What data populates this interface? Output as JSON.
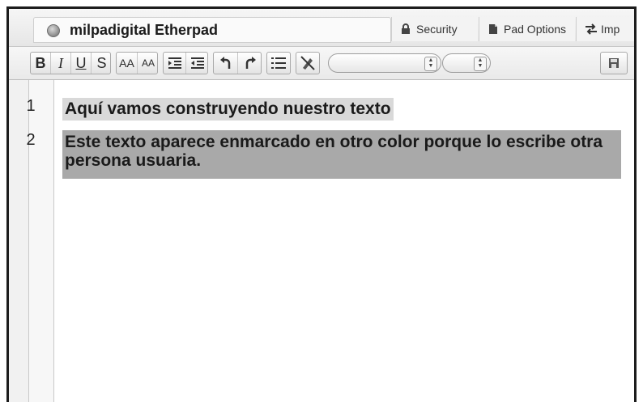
{
  "header": {
    "pad_title": "milpadigital Etherpad",
    "security_label": "Security",
    "pad_options_label": "Pad Options",
    "import_label": "Imp"
  },
  "toolbar": {
    "bold": "B",
    "italic": "I",
    "underline": "U",
    "strikethrough": "S",
    "font_size_up": "AA",
    "font_size_down": "AA",
    "icons": [
      "indent-icon",
      "outdent-icon",
      "undo-icon",
      "redo-icon",
      "list-icon",
      "clear-authorship-icon",
      "save-icon"
    ]
  },
  "editor": {
    "lines": [
      {
        "number": "1",
        "text": "Aquí vamos construyendo nuestro texto"
      },
      {
        "number": "2",
        "text": "Este texto aparece enmarcado en otro color porque lo escribe otra persona usuaria."
      }
    ]
  },
  "colors": {
    "author1_highlight": "#d9d9d9",
    "author2_highlight": "#a9a9a9"
  }
}
